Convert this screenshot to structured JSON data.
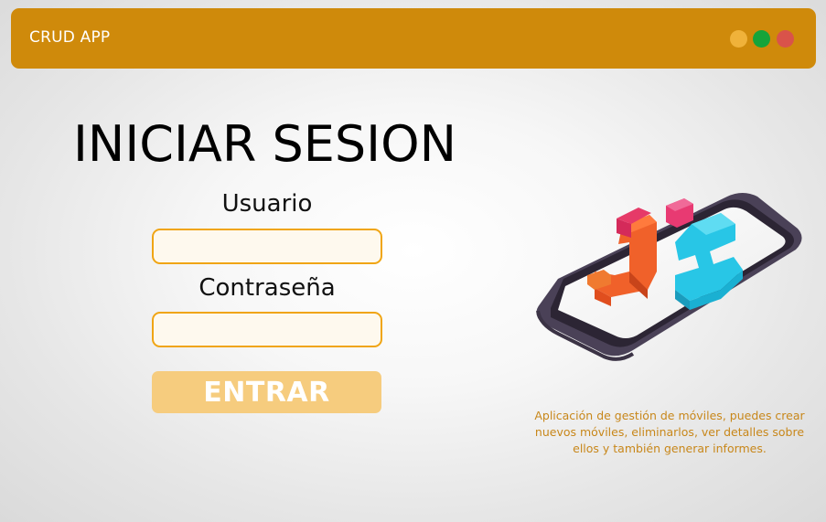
{
  "window": {
    "title": "CRUD APP",
    "controls": [
      {
        "name": "minimize",
        "color": "#f0b23a"
      },
      {
        "name": "maximize",
        "color": "#16a43a"
      },
      {
        "name": "close",
        "color": "#d9534a"
      }
    ]
  },
  "login": {
    "heading": "INICIAR SESION",
    "username_label": "Usuario",
    "username_value": "",
    "password_label": "Contraseña",
    "password_value": "",
    "submit_label": "ENTRAR"
  },
  "illustration": {
    "icon": "phone-with-3d-js-logo-icon"
  },
  "description": "Aplicación de gestión de móviles, puedes crear nuevos móviles, eliminarlos, ver detalles sobre ellos y también generar informes.",
  "colors": {
    "accent": "#cf8a0b",
    "input_border": "#f0a514",
    "button": "#f6cc7e",
    "description_text": "#c8871a"
  }
}
